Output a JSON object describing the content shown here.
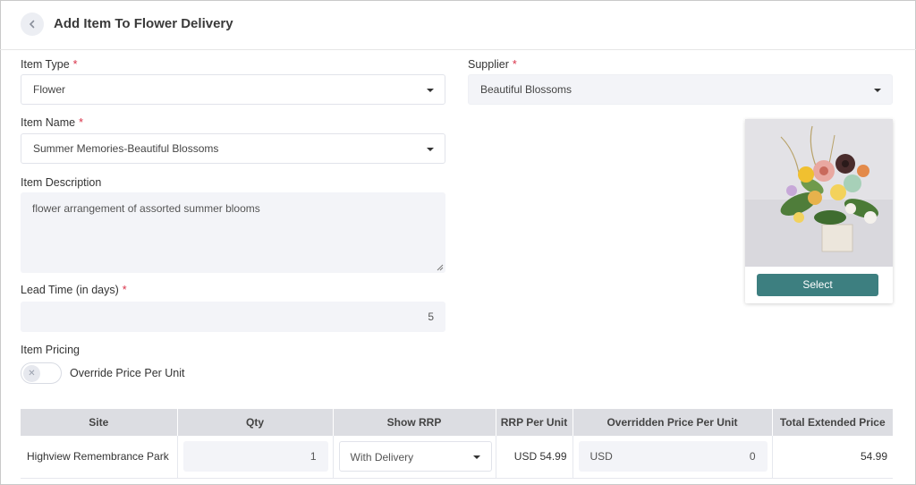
{
  "header": {
    "title": "Add Item To Flower Delivery"
  },
  "form": {
    "item_type": {
      "label": "Item Type",
      "required_mark": "*",
      "value": "Flower"
    },
    "supplier": {
      "label": "Supplier",
      "required_mark": "*",
      "value": "Beautiful Blossoms"
    },
    "item_name": {
      "label": "Item Name",
      "required_mark": "*",
      "value": "Summer Memories-Beautiful Blossoms"
    },
    "item_description": {
      "label": "Item Description",
      "value": "flower arrangement of assorted summer blooms"
    },
    "lead_time": {
      "label": "Lead Time (in days)",
      "required_mark": "*",
      "value": "5"
    },
    "item_pricing": {
      "label": "Item Pricing"
    },
    "override_toggle": {
      "label": "Override Price Per Unit",
      "state": "off"
    }
  },
  "image_card": {
    "button_label": "Select"
  },
  "pricing_table": {
    "columns": [
      "Site",
      "Qty",
      "Show RRP",
      "RRP Per Unit",
      "Overridden Price Per Unit",
      "Total Extended Price"
    ],
    "rows": [
      {
        "site": "Highview Remembrance Park",
        "qty": "1",
        "show_rrp": "With Delivery",
        "rrp_per_unit": "USD 54.99",
        "overridden_currency": "USD",
        "overridden_value": "0",
        "total": "54.99"
      }
    ]
  },
  "colors": {
    "accent": "#3d7f80",
    "required": "#d9334a",
    "table_header": "#dcdde2",
    "input_grey": "#f3f4f8"
  },
  "icons": {
    "back": "chevron-left-icon",
    "dropdown": "caret-down-icon",
    "toggle": "x-icon"
  }
}
